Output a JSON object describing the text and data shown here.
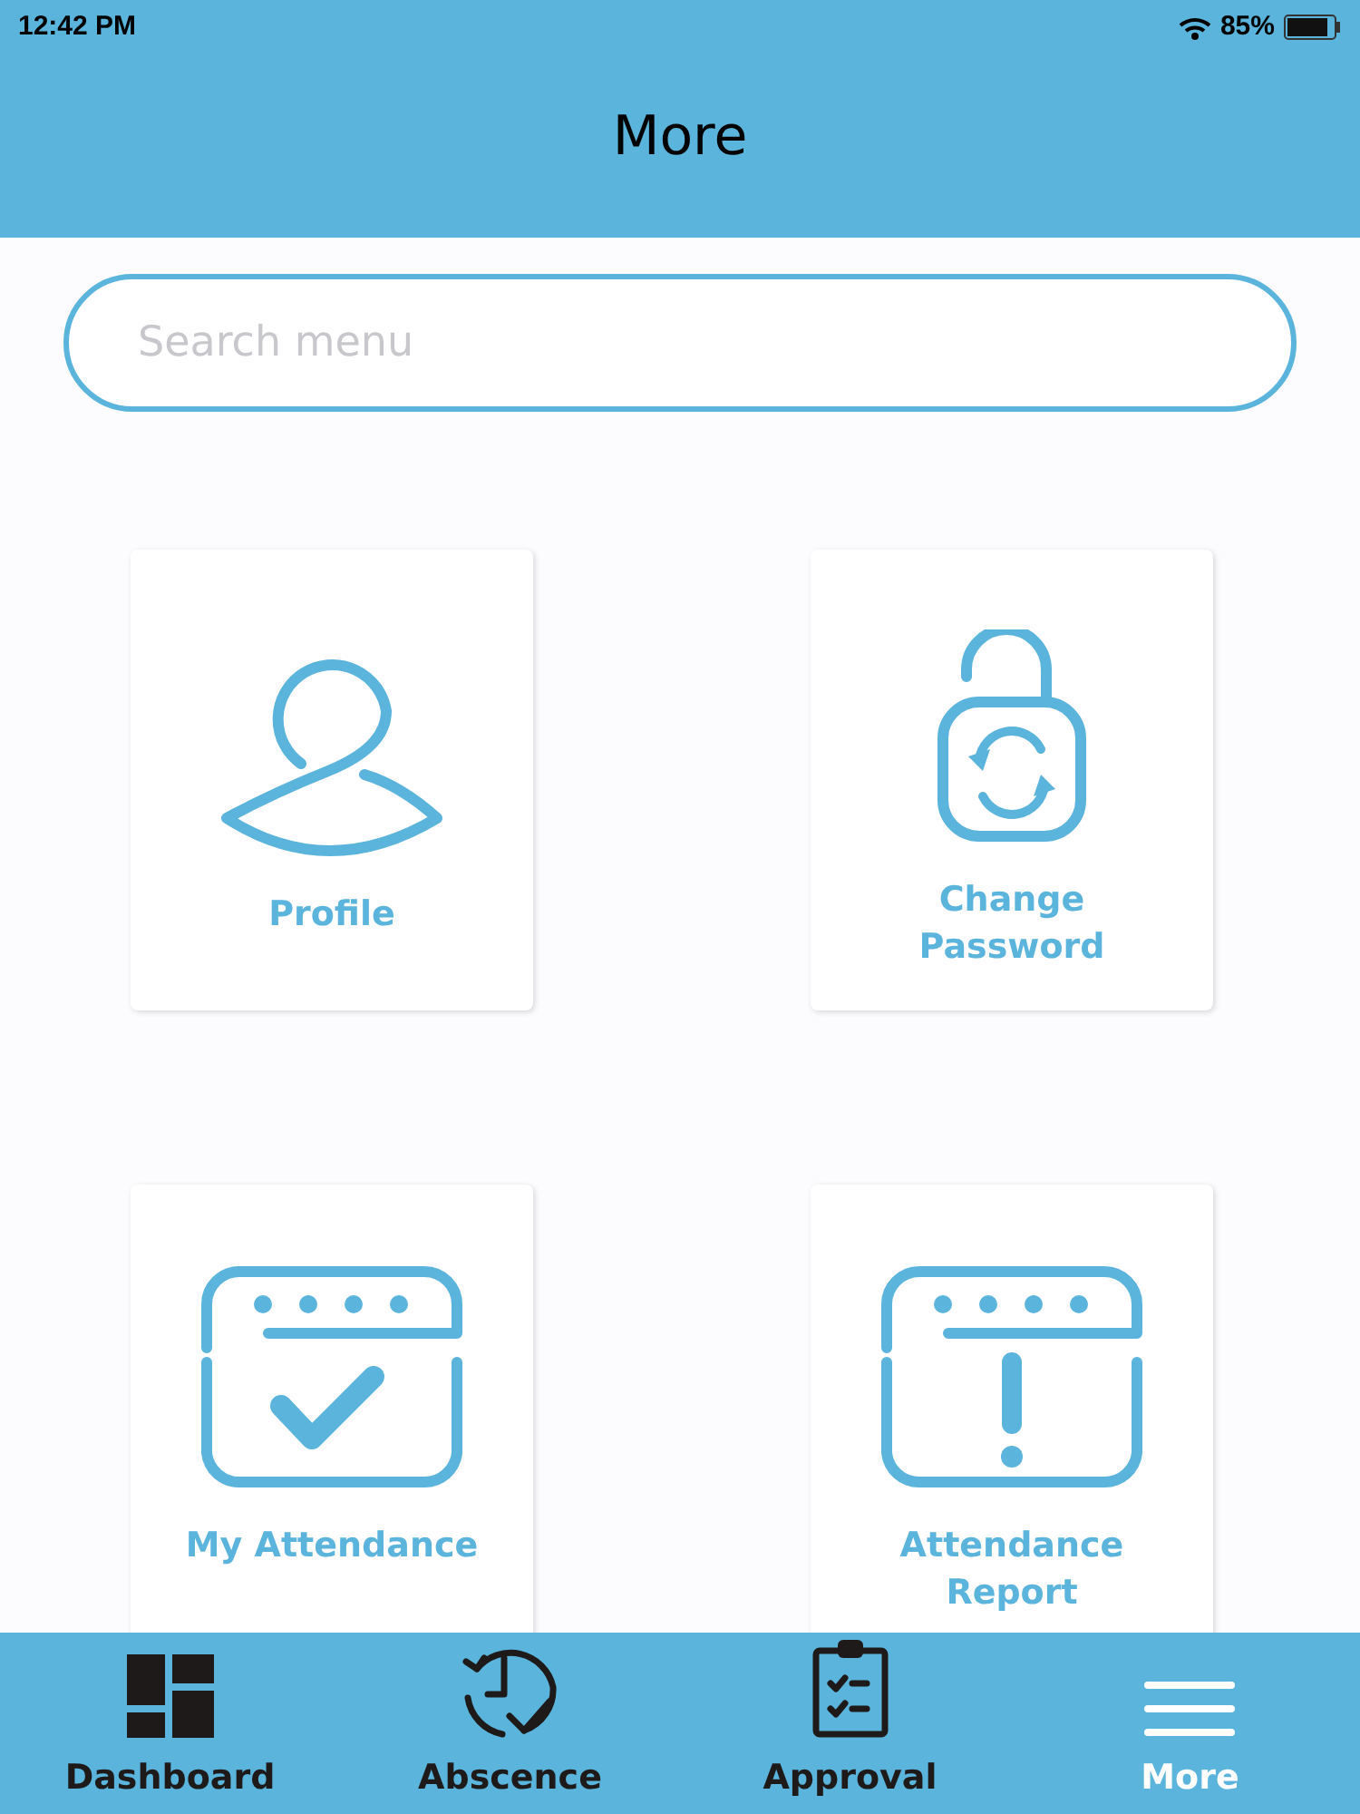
{
  "status_bar": {
    "time": "12:42 PM",
    "battery": "85%"
  },
  "header": {
    "title": "More"
  },
  "search": {
    "placeholder": "Search menu"
  },
  "menu_items": [
    {
      "kind": "profile",
      "label": "Profile"
    },
    {
      "kind": "lock",
      "label": "Change Password"
    },
    {
      "kind": "calendar-check",
      "label": "My Attendance"
    },
    {
      "kind": "calendar-alert",
      "label": "Attendance Report"
    }
  ],
  "tab_bar": [
    {
      "kind": "dashboard",
      "label": "Dashboard",
      "selected": false
    },
    {
      "kind": "absence",
      "label": "Abscence",
      "selected": false
    },
    {
      "kind": "approval",
      "label": "Approval",
      "selected": false
    },
    {
      "kind": "more",
      "label": "More",
      "selected": true
    }
  ]
}
